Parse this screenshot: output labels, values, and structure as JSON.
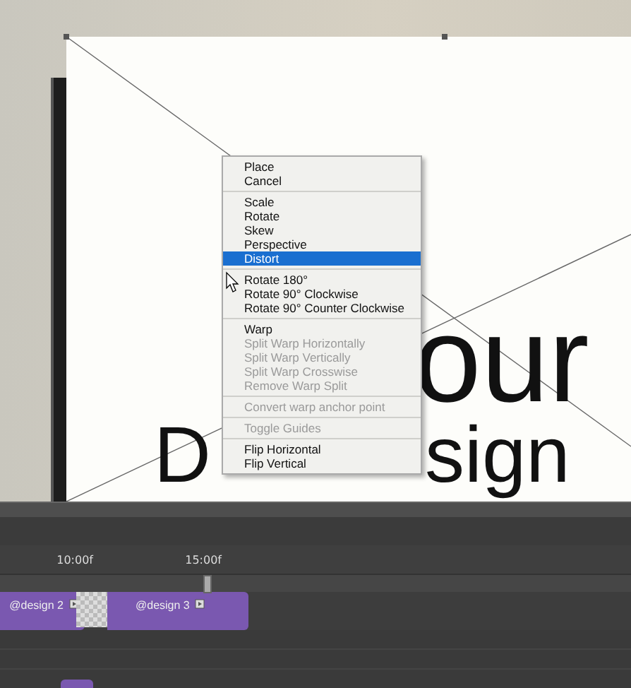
{
  "canvas": {
    "texts": [
      {
        "text": "our"
      },
      {
        "text": "D"
      },
      {
        "text": "sign"
      }
    ]
  },
  "menu": {
    "sections": [
      {
        "items": [
          {
            "label": "Place",
            "disabled": false,
            "selected": false
          },
          {
            "label": "Cancel",
            "disabled": false,
            "selected": false
          }
        ]
      },
      {
        "items": [
          {
            "label": "Scale",
            "disabled": false,
            "selected": false
          },
          {
            "label": "Rotate",
            "disabled": false,
            "selected": false
          },
          {
            "label": "Skew",
            "disabled": false,
            "selected": false
          },
          {
            "label": "Perspective",
            "disabled": false,
            "selected": false
          },
          {
            "label": "Distort",
            "disabled": false,
            "selected": true
          }
        ]
      },
      {
        "items": [
          {
            "label": "Rotate 180°",
            "disabled": false,
            "selected": false
          },
          {
            "label": "Rotate 90° Clockwise",
            "disabled": false,
            "selected": false
          },
          {
            "label": "Rotate 90° Counter Clockwise",
            "disabled": false,
            "selected": false
          }
        ]
      },
      {
        "items": [
          {
            "label": "Warp",
            "disabled": false,
            "selected": false
          },
          {
            "label": "Split Warp Horizontally",
            "disabled": true,
            "selected": false
          },
          {
            "label": "Split Warp Vertically",
            "disabled": true,
            "selected": false
          },
          {
            "label": "Split Warp Crosswise",
            "disabled": true,
            "selected": false
          },
          {
            "label": "Remove Warp Split",
            "disabled": true,
            "selected": false
          }
        ]
      },
      {
        "items": [
          {
            "label": "Convert warp anchor point",
            "disabled": true,
            "selected": false
          }
        ]
      },
      {
        "items": [
          {
            "label": "Toggle Guides",
            "disabled": true,
            "selected": false
          }
        ]
      },
      {
        "items": [
          {
            "label": "Flip Horizontal",
            "disabled": false,
            "selected": false
          },
          {
            "label": "Flip Vertical",
            "disabled": false,
            "selected": false
          }
        ]
      }
    ]
  },
  "timeline": {
    "ruler": [
      "10:00f",
      "15:00f"
    ],
    "clips": [
      {
        "label": "@design 2"
      },
      {
        "label": "@design 3"
      }
    ]
  }
}
